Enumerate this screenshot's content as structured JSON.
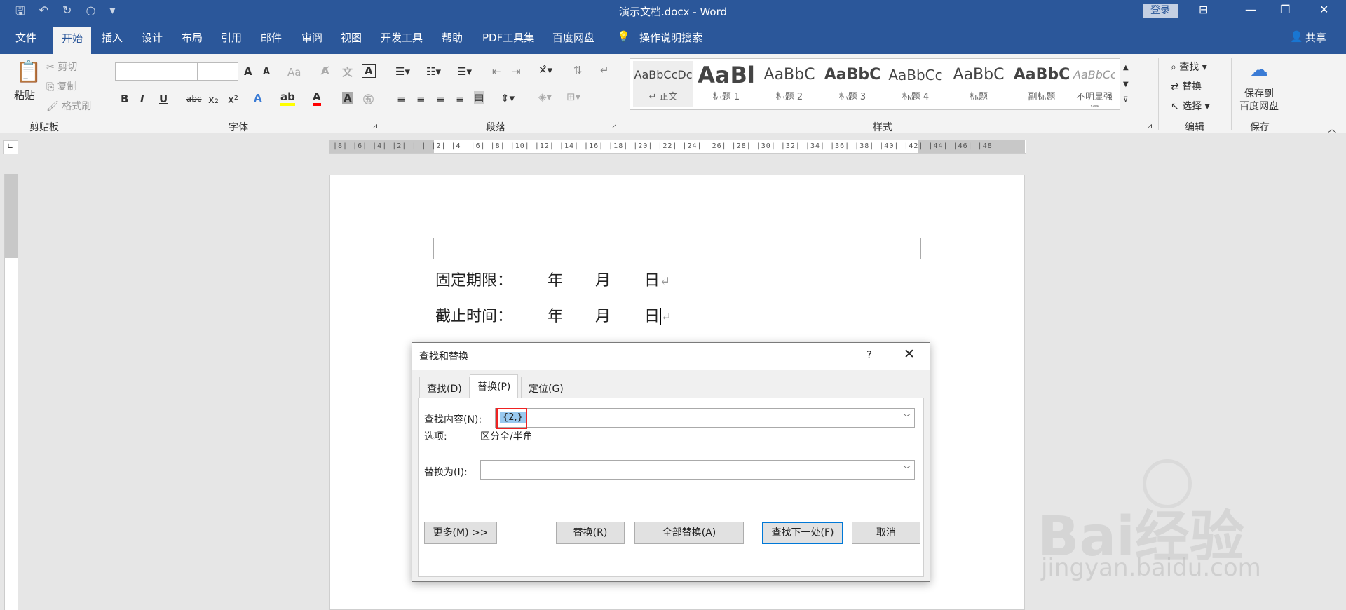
{
  "title_bar": {
    "doc_title": "演示文档.docx  -  Word",
    "login": "登录",
    "qat": {
      "save_icon": "save-icon",
      "undo_icon": "undo-icon",
      "redo_icon": "redo-icon",
      "custom": "▾"
    }
  },
  "tabs": [
    "文件",
    "开始",
    "插入",
    "设计",
    "布局",
    "引用",
    "邮件",
    "审阅",
    "视图",
    "开发工具",
    "帮助",
    "PDF工具集",
    "百度网盘"
  ],
  "tell_me": "操作说明搜索",
  "share": "共享",
  "clipboard": {
    "paste": "粘贴",
    "cut": "剪切",
    "copy": "复制",
    "format_painter": "格式刷",
    "group": "剪贴板"
  },
  "font": {
    "group": "字体",
    "bold": "B",
    "italic": "I",
    "underline": "U",
    "strike": "abc",
    "sub": "x₂",
    "sup": "x²",
    "grow": "A",
    "shrink": "A",
    "case": "Aa",
    "colors": {
      "highlight": "#ffff00",
      "font_color": "#ff0000"
    }
  },
  "paragraph": {
    "group": "段落"
  },
  "styles": {
    "group": "样式",
    "items": [
      {
        "preview": "AaBbCcDc",
        "name": "↵ 正文"
      },
      {
        "preview": "AaBl",
        "name": "标题 1"
      },
      {
        "preview": "AaBbC",
        "name": "标题 2"
      },
      {
        "preview": "AaBbC",
        "name": "标题 3"
      },
      {
        "preview": "AaBbCc",
        "name": "标题 4"
      },
      {
        "preview": "AaBbC",
        "name": "标题"
      },
      {
        "preview": "AaBbC",
        "name": "副标题"
      },
      {
        "preview": "AaBbCcD",
        "name": "不明显强调"
      }
    ]
  },
  "editing": {
    "find": "查找",
    "replace": "替换",
    "select": "选择",
    "group": "编辑"
  },
  "save": {
    "label": "保存到\n百度网盘",
    "group": "保存"
  },
  "ruler_numbers": "|8| |6| |4| |2| | | |2| |4| |6| |8| |10| |12| |14| |16| |18| |20| |22| |24| |26| |28| |30| |32| |34| |36| |38| |40| |42| |44| |46| |48",
  "document": {
    "line1": {
      "label": "固定期限：",
      "year": "年",
      "month": "月",
      "day": "日"
    },
    "line2": {
      "label": "截止时间：",
      "year": "年",
      "month": "月",
      "day": "日"
    }
  },
  "dialog": {
    "title": "查找和替换",
    "help": "?",
    "close": "✕",
    "tabs": [
      "查找(D)",
      "替换(P)",
      "定位(G)"
    ],
    "find_label": "查找内容(N):",
    "find_value": "{2,}",
    "options_label": "选项:",
    "options_value": "区分全/半角",
    "replace_label": "替换为(I):",
    "replace_value": "",
    "buttons": {
      "more": "更多(M) >>",
      "replace": "替换(R)",
      "replace_all": "全部替换(A)",
      "find_next": "查找下一处(F)",
      "cancel": "取消"
    }
  },
  "watermark": {
    "brand": "Bai经验",
    "url": "jingyan.baidu.com"
  }
}
